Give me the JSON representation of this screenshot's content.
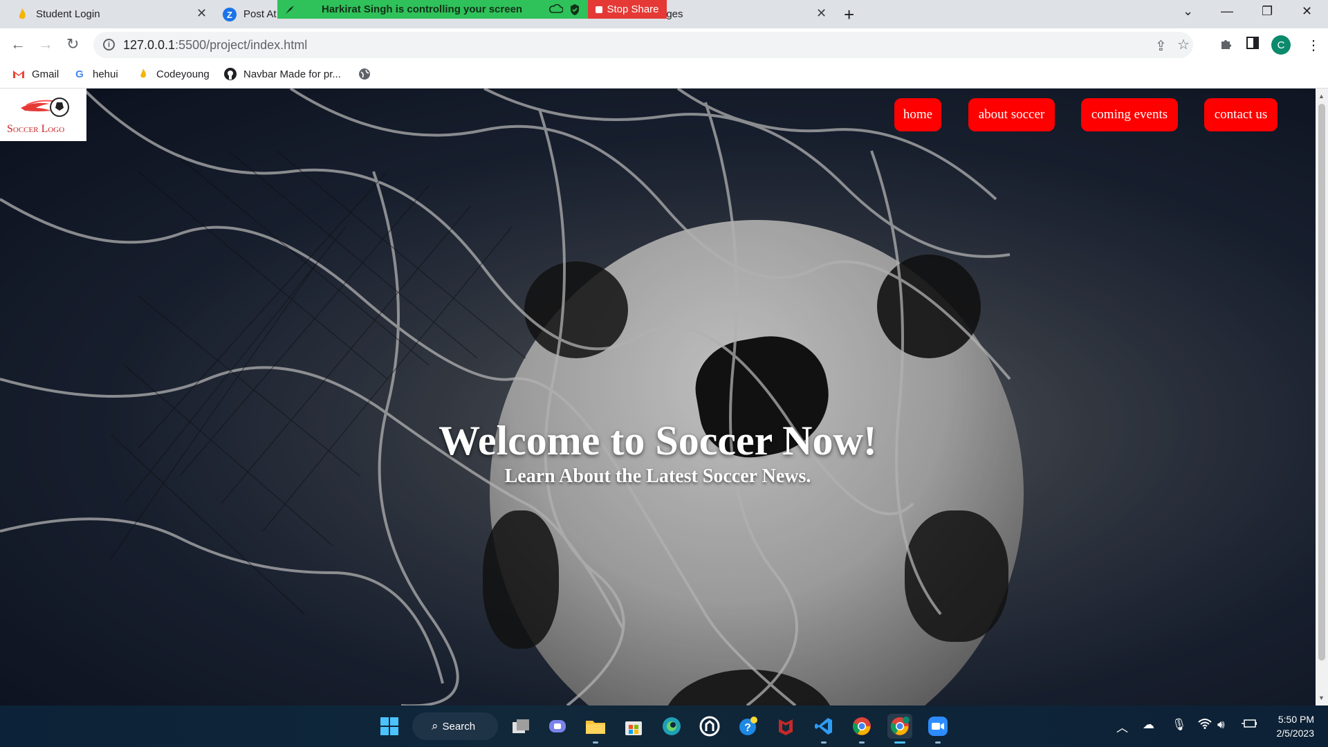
{
  "browser": {
    "tabs": [
      {
        "title": "Student Login"
      },
      {
        "title": "Post At"
      },
      {
        "title": "ages"
      }
    ],
    "share_banner": {
      "text": "Harkirat Singh is controlling your screen",
      "stop_label": "Stop Share"
    },
    "url_host": "127.0.0.1",
    "url_path": ":5500/project/index.html",
    "avatar_letter": "C",
    "bookmarks": [
      {
        "label": "Gmail",
        "icon": "gmail-icon"
      },
      {
        "label": "hehui",
        "icon": "google-icon"
      },
      {
        "label": "Codeyoung",
        "icon": "codeyoung-icon"
      },
      {
        "label": "Navbar Made for pr...",
        "icon": "github-icon"
      },
      {
        "label": "",
        "icon": "globe-icon"
      }
    ]
  },
  "page": {
    "logo_text": "Soccer Logo",
    "nav": [
      "home",
      "about soccer",
      "coming events",
      "contact us"
    ],
    "hero_title": "Welcome to Soccer Now!",
    "hero_subtitle": "Learn About the Latest Soccer News.",
    "accent_color": "#ff0000"
  },
  "taskbar": {
    "search_label": "Search",
    "time": "5:50 PM",
    "date": "2/5/2023"
  }
}
